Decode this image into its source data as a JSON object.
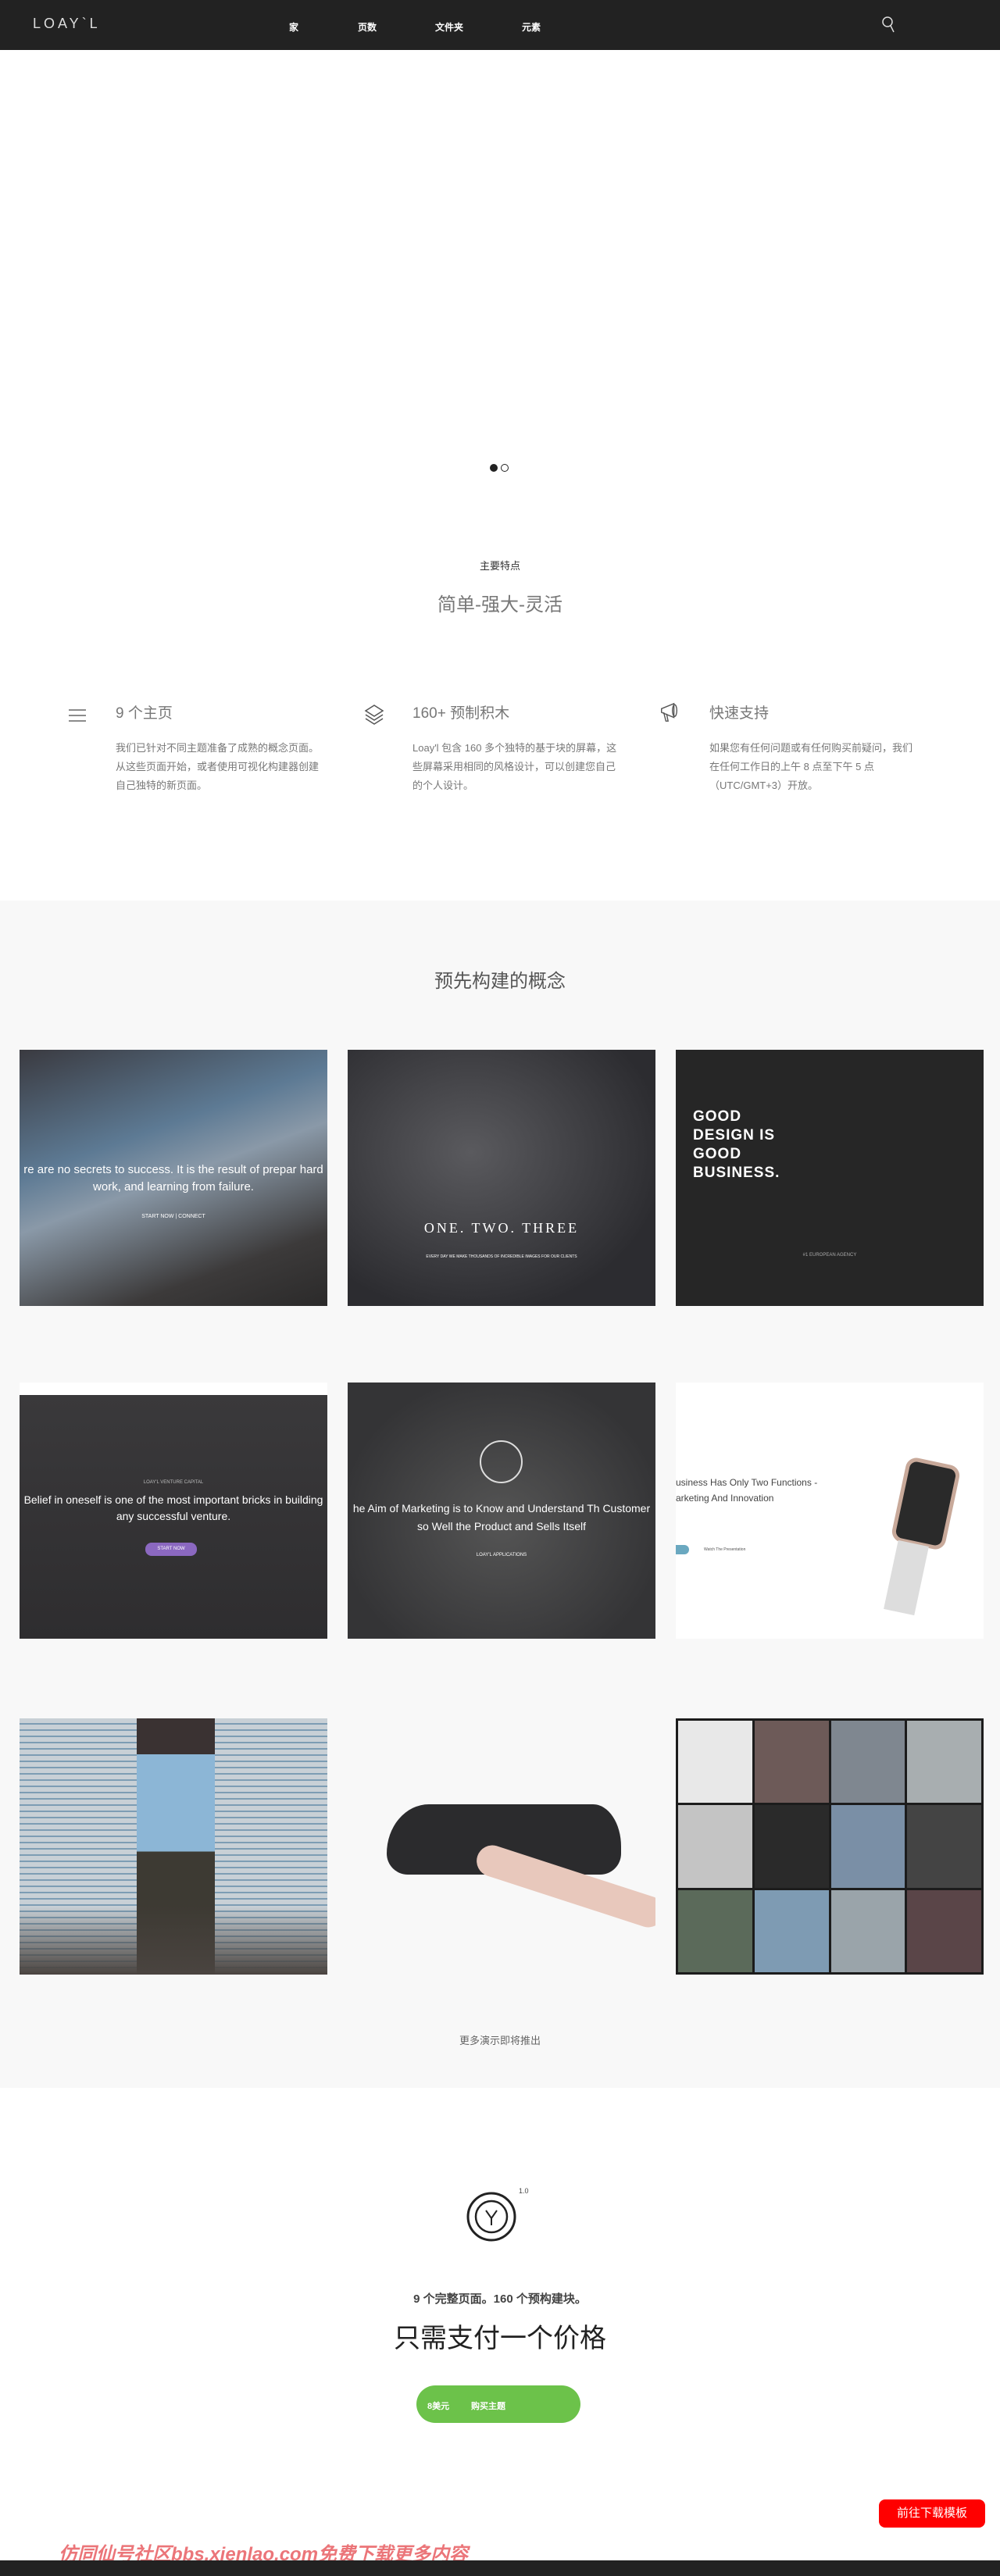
{
  "nav": {
    "logo": "LOAY`L",
    "items": [
      "家",
      "页数",
      "文件夹",
      "元素"
    ],
    "search_icon": "search-icon"
  },
  "slider": {
    "dots": 2,
    "active": 1
  },
  "features": {
    "kicker": "主要特点",
    "title": "简单-强大-灵活",
    "items": [
      {
        "icon": "menu-lines-icon",
        "title": "9 个主页",
        "text": "我们已针对不同主题准备了成熟的概念页面。从这些页面开始，或者使用可视化构建器创建自己独特的新页面。"
      },
      {
        "icon": "layers-icon",
        "title": "160+ 预制积木",
        "text": "Loay'l 包含 160 多个独特的基于块的屏幕，这些屏幕采用相同的风格设计，可以创建您自己的个人设计。"
      },
      {
        "icon": "megaphone-icon",
        "title": "快速支持",
        "text": "如果您有任何问题或有任何购买前疑问，我们在任何工作日的上午 8 点至下午 5 点（UTC/GMT+3）开放。"
      }
    ]
  },
  "concepts": {
    "title": "预先构建的概念",
    "thumbs": [
      {
        "text": "re are no secrets to success. It is the result of prepar hard work, and learning from failure.",
        "sub": "START NOW   |   CONNECT"
      },
      {
        "text": "ONE. TWO. THREE",
        "sub": "EVERY DAY WE MAKE THOUSANDS OF INCREDIBLE IMAGES FOR OUR CLIENTS"
      },
      {
        "text": "GOOD DESIGN IS GOOD BUSINESS.",
        "sub": "#1 EUROPEAN AGENCY"
      },
      {
        "text": "Belief in oneself is one of the most important bricks in building any successful venture.",
        "sub": "LOAY'L VENTURE CAPITAL",
        "btn": "START NOW"
      },
      {
        "text": "he Aim of Marketing is to Know and Understand Th Customer so Well the Product and Sells Itself",
        "sub": "LOAY'L APPLICATIONS"
      },
      {
        "text": "usiness Has Only Two Functions - arketing And Innovation",
        "sub": "Watch The Presentation"
      },
      {
        "text": "",
        "sub": ""
      },
      {
        "text": "",
        "sub": ""
      },
      {
        "text": "",
        "sub": ""
      }
    ],
    "more": "更多演示即将推出"
  },
  "pricing": {
    "version": "1.0",
    "line": "9 个完整页面。160 个预构建块。",
    "title": "只需支付一个价格",
    "price": "8美元",
    "buy": "购买主题",
    "accent": "#6cc24a"
  },
  "download": {
    "label": "前往下载模板"
  },
  "watermark": "仿同仙号社区bbs.xienlao.com免费下载更多内容"
}
